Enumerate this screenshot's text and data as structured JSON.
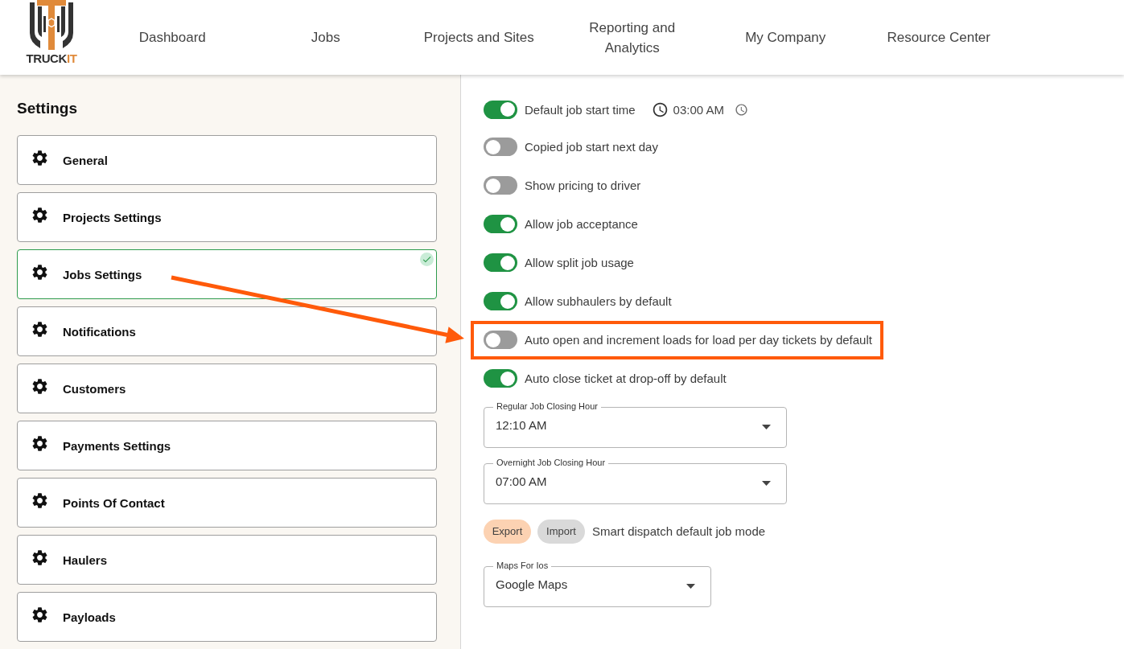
{
  "logo": {
    "wordmark": "TRUCK",
    "wordmark_accent": "IT"
  },
  "nav": [
    {
      "label": "Dashboard"
    },
    {
      "label": "Jobs"
    },
    {
      "label": "Projects and Sites"
    },
    {
      "label": "Reporting and Analytics"
    },
    {
      "label": "My Company"
    },
    {
      "label": "Resource Center"
    }
  ],
  "sidebar": {
    "title": "Settings",
    "items": [
      {
        "label": "General",
        "selected": false
      },
      {
        "label": "Projects Settings",
        "selected": false
      },
      {
        "label": "Jobs Settings",
        "selected": true
      },
      {
        "label": "Notifications",
        "selected": false
      },
      {
        "label": "Customers",
        "selected": false
      },
      {
        "label": "Payments Settings",
        "selected": false
      },
      {
        "label": "Points Of Contact",
        "selected": false
      },
      {
        "label": "Haulers",
        "selected": false
      },
      {
        "label": "Payloads",
        "selected": false
      }
    ]
  },
  "settings": {
    "toggles": [
      {
        "kind": "toggle-with-time",
        "label": "Default job start time",
        "on": true,
        "highlighted": false,
        "time": "03:00 AM"
      },
      {
        "kind": "toggle",
        "label": "Copied job start next day",
        "on": false,
        "highlighted": false
      },
      {
        "kind": "toggle",
        "label": "Show pricing to driver",
        "on": false,
        "highlighted": false
      },
      {
        "kind": "toggle",
        "label": "Allow job acceptance",
        "on": true,
        "highlighted": false
      },
      {
        "kind": "toggle",
        "label": "Allow split job usage",
        "on": true,
        "highlighted": false
      },
      {
        "kind": "toggle",
        "label": "Allow subhaulers by default",
        "on": true,
        "highlighted": false
      },
      {
        "kind": "toggle",
        "label": "Auto open and increment loads for load per day tickets by default",
        "on": false,
        "highlighted": true
      },
      {
        "kind": "toggle",
        "label": "Auto close ticket at drop-off by default",
        "on": true,
        "highlighted": false
      }
    ],
    "closing_hours": [
      {
        "label": "Regular Job Closing Hour",
        "value": "12:10 AM"
      },
      {
        "label": "Overnight Job Closing Hour",
        "value": "07:00 AM"
      }
    ],
    "smart_dispatch": {
      "options": [
        {
          "label": "Export",
          "selected": true
        },
        {
          "label": "Import",
          "selected": false
        }
      ],
      "label": "Smart dispatch default job mode"
    },
    "maps_for_ios": {
      "label": "Maps For Ios",
      "value": "Google Maps"
    }
  }
}
